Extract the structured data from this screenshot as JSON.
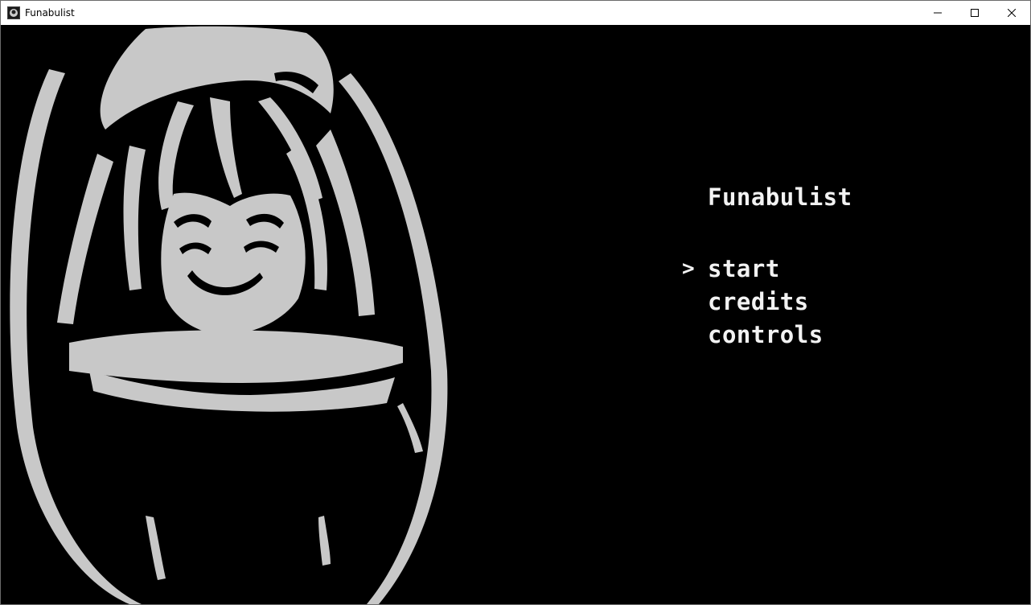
{
  "window": {
    "title": "Funabulist",
    "icon": "app-icon",
    "controls": {
      "minimize_icon": "minimize-icon",
      "maximize_icon": "maximize-icon",
      "close_icon": "close-icon"
    }
  },
  "game": {
    "title": "Funabulist",
    "selector_glyph": ">",
    "selected_index": 0,
    "menu": [
      {
        "label": "start"
      },
      {
        "label": "credits"
      },
      {
        "label": "controls"
      }
    ],
    "colors": {
      "background": "#000000",
      "foreground": "#f2f2f2",
      "portrait": "#c8c8c8"
    }
  }
}
